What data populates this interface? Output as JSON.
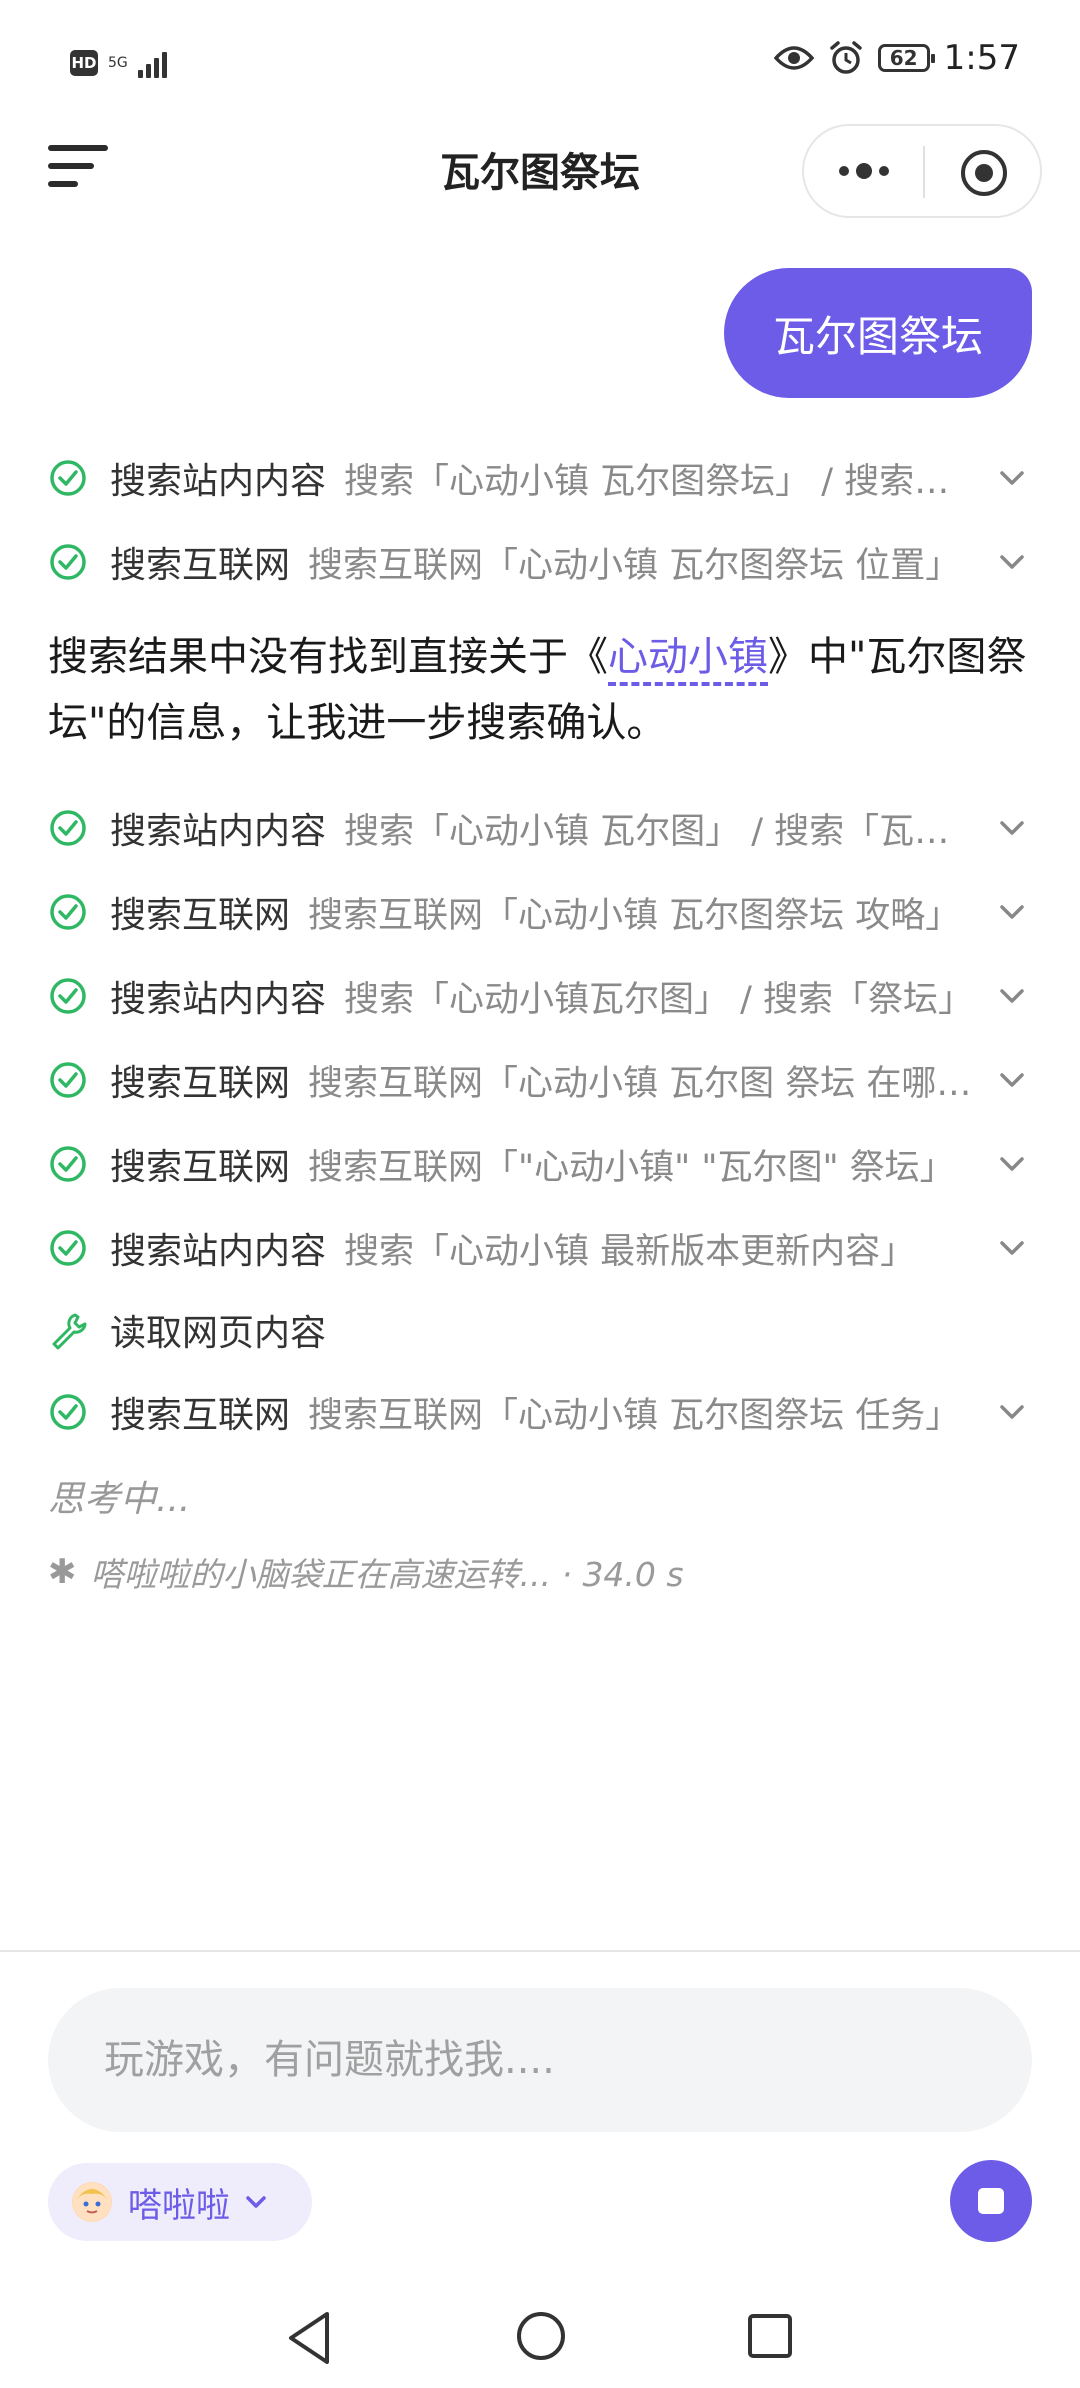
{
  "status_bar": {
    "hd": "HD",
    "network": "5G",
    "battery": "62",
    "time": "1:57"
  },
  "header": {
    "title": "瓦尔图祭坛"
  },
  "user_message": "瓦尔图祭坛",
  "steps_top": [
    {
      "label": "搜索站内内容",
      "detail": "搜索「心动小镇 瓦尔图祭坛」 / 搜索「瓦尔图祭坛」"
    },
    {
      "label": "搜索互联网",
      "detail": "搜索互联网「心动小镇 瓦尔图祭坛 位置」"
    }
  ],
  "answer": {
    "before": "搜索结果中没有找到直接关于《",
    "link": "心动小镇",
    "after": "》中\"瓦尔图祭坛\"的信息，让我进一步搜索确认。"
  },
  "steps_bottom": [
    {
      "label": "搜索站内内容",
      "detail": "搜索「心动小镇 瓦尔图」 / 搜索「瓦尔图」",
      "icon": "check"
    },
    {
      "label": "搜索互联网",
      "detail": "搜索互联网「心动小镇 瓦尔图祭坛 攻略」",
      "icon": "check"
    },
    {
      "label": "搜索站内内容",
      "detail": "搜索「心动小镇瓦尔图」 / 搜索「祭坛」",
      "icon": "check"
    },
    {
      "label": "搜索互联网",
      "detail": "搜索互联网「心动小镇 瓦尔图 祭坛 在哪里」",
      "icon": "check"
    },
    {
      "label": "搜索互联网",
      "detail": "搜索互联网「\"心动小镇\" \"瓦尔图\" 祭坛」",
      "icon": "check"
    },
    {
      "label": "搜索站内内容",
      "detail": "搜索「心动小镇 最新版本更新内容」",
      "icon": "check"
    },
    {
      "label": "读取网页内容",
      "detail": "",
      "icon": "wrench"
    },
    {
      "label": "搜索互联网",
      "detail": "搜索互联网「心动小镇 瓦尔图祭坛 任务」",
      "icon": "check"
    }
  ],
  "thinking": "思考中...",
  "status_line": "嗒啦啦的小脑袋正在高速运转... · 34.0 s",
  "composer": {
    "placeholder": "玩游戏，有问题就找我....",
    "agent_name": "嗒啦啦"
  },
  "colors": {
    "accent": "#6c5ce7",
    "success": "#2fb864"
  }
}
